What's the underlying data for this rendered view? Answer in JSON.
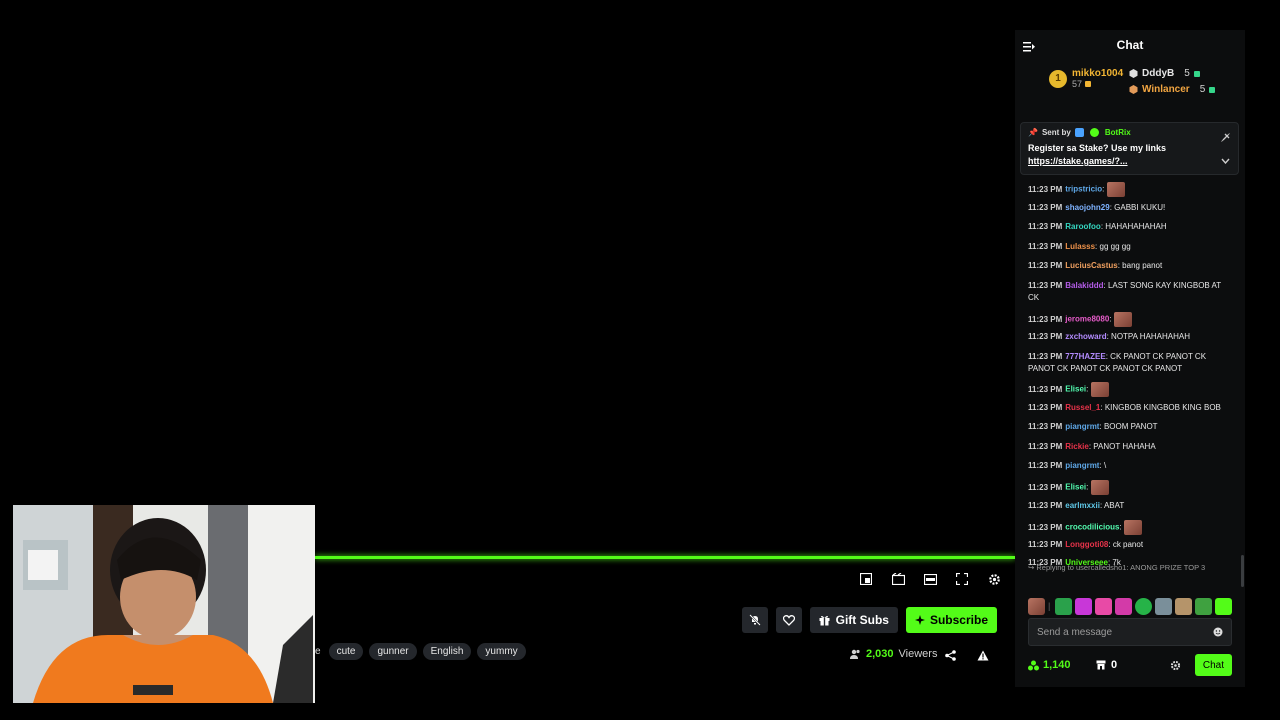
{
  "player": {
    "controls": [
      "miniplayer-icon",
      "theater-icon",
      "captions-icon",
      "fullscreen-icon",
      "settings-icon"
    ]
  },
  "stream": {
    "tag_partial": "e",
    "tags": [
      "cute",
      "gunner",
      "English",
      "yummy"
    ],
    "viewers_count": "2,030",
    "viewers_label": "Viewers",
    "gift_label": "Gift Subs",
    "subscribe_label": "Subscribe"
  },
  "chat": {
    "title": "Chat",
    "leaderboard": {
      "first": {
        "rank": "1",
        "name": "mikko1004",
        "points": "57"
      },
      "rows": [
        {
          "name": "DddyB",
          "points": "5",
          "color": "#e6e6e6"
        },
        {
          "name": "Winlancer",
          "points": "5",
          "color": "#f2a541"
        }
      ]
    },
    "pinned": {
      "sent_by": "Sent by",
      "bot_name": "BotRix",
      "text": "Register sa Stake? Use my links",
      "link": "https://stake.games/?..."
    },
    "messages": [
      {
        "time": "11:23 PM",
        "user": "tripstricio",
        "color": "#5fa8e8",
        "text": "",
        "emote": true
      },
      {
        "time": "11:23 PM",
        "user": "shaojohn29",
        "color": "#7fb3ff",
        "text": "GABBI KUKU!"
      },
      {
        "time": "11:23 PM",
        "user": "Raroofoo",
        "color": "#35d6c0",
        "text": "HAHAHAHAHAH"
      },
      {
        "time": "11:23 PM",
        "user": "Lulasss",
        "color": "#f0924a",
        "text": "gg gg gg"
      },
      {
        "time": "11:23 PM",
        "user": "LuciusCastus",
        "color": "#f0a060",
        "text": "bang panot"
      },
      {
        "time": "11:23 PM",
        "user": "Balakiddd",
        "color": "#b45ce8",
        "text": "LAST SONG KAY KINGBOB AT CK"
      },
      {
        "time": "11:23 PM",
        "user": "jerome8080",
        "color": "#e65cc9",
        "text": "",
        "emote": true
      },
      {
        "time": "11:23 PM",
        "user": "zxchoward",
        "color": "#b48cff",
        "text": "NOTPA HAHAHAHAH"
      },
      {
        "time": "11:23 PM",
        "user": "777HAZEE",
        "color": "#b48cff",
        "text": "CK PANOT CK PANOT CK PANOT CK PANOT CK PANOT CK PANOT"
      },
      {
        "time": "11:23 PM",
        "user": "Elisei",
        "color": "#53fcb0",
        "text": "",
        "emote": true
      },
      {
        "time": "11:23 PM",
        "user": "Russel_1",
        "color": "#e8334a",
        "text": "KINGBOB KINGBOB KING BOB"
      },
      {
        "time": "11:23 PM",
        "user": "piangrmt",
        "color": "#5fa8e8",
        "text": "BOOM PANOT"
      },
      {
        "time": "11:23 PM",
        "user": "Rickie",
        "color": "#e8334a",
        "text": "PANOT HAHAHA"
      },
      {
        "time": "11:23 PM",
        "user": "piangrmt",
        "color": "#5fa8e8",
        "text": "\\"
      },
      {
        "time": "11:23 PM",
        "user": "Elisei",
        "color": "#53fcb0",
        "text": "",
        "emote": true
      },
      {
        "time": "11:23 PM",
        "user": "earlmxxii",
        "color": "#5fc8e8",
        "text": "ABAT"
      },
      {
        "time": "11:23 PM",
        "user": "crocodilicious",
        "color": "#53fcb0",
        "text": "",
        "emote": true
      },
      {
        "time": "11:23 PM",
        "user": "Longgoti08",
        "color": "#e8334a",
        "text": "ck panot"
      },
      {
        "time": "11:23 PM",
        "user": "Universeee",
        "color": "#53fc18",
        "text": "7k"
      }
    ],
    "reply_to": "Replying to usercalledsho1: ANONG PRIZE TOP 3",
    "input_placeholder": "Send a message",
    "points": "1,140",
    "store_count": "0",
    "send_label": "Chat"
  },
  "colors": {
    "accent": "#53fc18",
    "panel": "#0c0d0e"
  }
}
